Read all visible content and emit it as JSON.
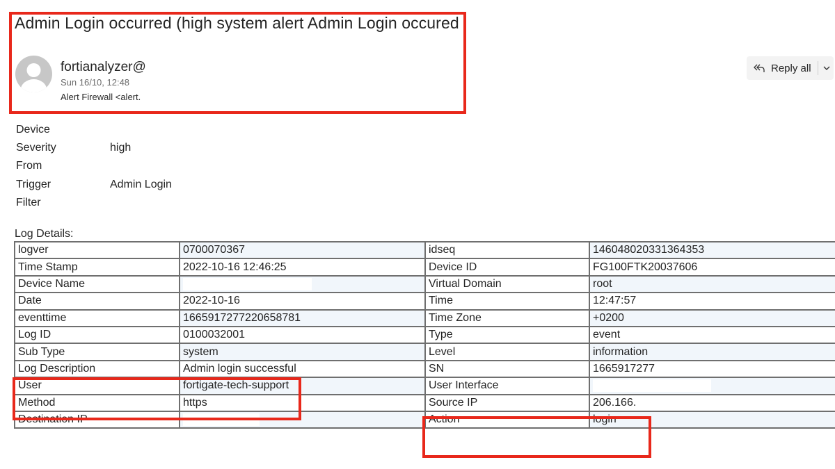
{
  "email": {
    "subject": "Admin Login occurred (high system alert Admin Login occured",
    "sender": "fortianalyzer@",
    "date": "Sun 16/10, 12:48",
    "recipient": "Alert Firewall <alert."
  },
  "toolbar": {
    "reply_all_label": "Reply all"
  },
  "props": [
    {
      "key": "Device",
      "value": ""
    },
    {
      "key": "Severity",
      "value": "high"
    },
    {
      "key": "From",
      "value": ""
    },
    {
      "key": "Trigger",
      "value": "Admin Login"
    },
    {
      "key": "Filter",
      "value": ""
    }
  ],
  "log_details_label": "Log Details:",
  "log_rows": [
    {
      "k1": "logver",
      "v1": "0700070367",
      "k2": "idseq",
      "v2": "146048020331364353"
    },
    {
      "k1": "Time Stamp",
      "v1": "2022-10-16 12:46:25",
      "k2": "Device ID",
      "v2": "FG100FTK20037606"
    },
    {
      "k1": "Device Name",
      "v1": "",
      "k2": "Virtual Domain",
      "v2": "root"
    },
    {
      "k1": "Date",
      "v1": "2022-10-16",
      "k2": "Time",
      "v2": "12:47:57"
    },
    {
      "k1": "eventtime",
      "v1": "1665917277220658781",
      "k2": "Time Zone",
      "v2": "+0200"
    },
    {
      "k1": "Log ID",
      "v1": "0100032001",
      "k2": "Type",
      "v2": "event"
    },
    {
      "k1": "Sub Type",
      "v1": "system",
      "k2": "Level",
      "v2": "information"
    },
    {
      "k1": "Log Description",
      "v1": "Admin login successful",
      "k2": "SN",
      "v2": "1665917277"
    },
    {
      "k1": "User",
      "v1": "fortigate-tech-support",
      "k2": "User Interface",
      "v2": ""
    },
    {
      "k1": "Method",
      "v1": "https",
      "k2": "Source IP",
      "v2": "206.166."
    },
    {
      "k1": "Destination IP",
      "v1": "",
      "k2": "Action",
      "v2": "login"
    }
  ],
  "colors": {
    "highlight": "#e8281b",
    "value_cell_bg": "#f1f6fb",
    "border": "#6f6f6f"
  }
}
